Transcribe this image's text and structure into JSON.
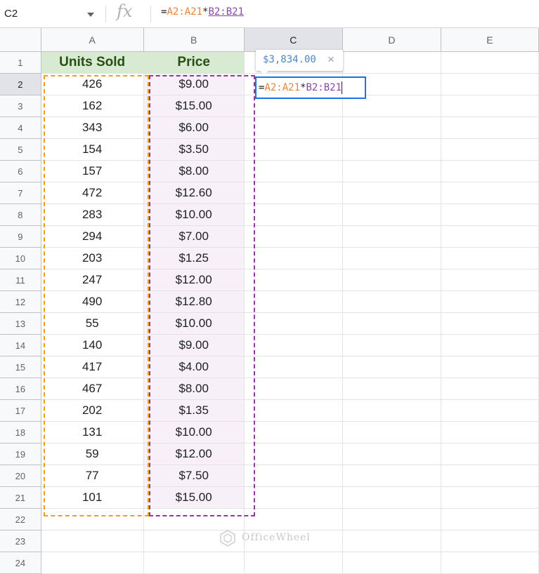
{
  "name_box": {
    "value": "C2"
  },
  "formula_bar": {
    "fx_label": "fx",
    "eq": "=",
    "ref_a": "A2:A21",
    "op": "*",
    "ref_b": "B2:B21"
  },
  "columns": [
    "A",
    "B",
    "C",
    "D",
    "E"
  ],
  "headers": {
    "units": "Units Sold",
    "price": "Price"
  },
  "rows": [
    {
      "n": "1"
    },
    {
      "n": "2",
      "units": "426",
      "price": "$9.00"
    },
    {
      "n": "3",
      "units": "162",
      "price": "$15.00"
    },
    {
      "n": "4",
      "units": "343",
      "price": "$6.00"
    },
    {
      "n": "5",
      "units": "154",
      "price": "$3.50"
    },
    {
      "n": "6",
      "units": "157",
      "price": "$8.00"
    },
    {
      "n": "7",
      "units": "472",
      "price": "$12.60"
    },
    {
      "n": "8",
      "units": "283",
      "price": "$10.00"
    },
    {
      "n": "9",
      "units": "294",
      "price": "$7.00"
    },
    {
      "n": "10",
      "units": "203",
      "price": "$1.25"
    },
    {
      "n": "11",
      "units": "247",
      "price": "$12.00"
    },
    {
      "n": "12",
      "units": "490",
      "price": "$12.80"
    },
    {
      "n": "13",
      "units": "55",
      "price": "$10.00"
    },
    {
      "n": "14",
      "units": "140",
      "price": "$9.00"
    },
    {
      "n": "15",
      "units": "417",
      "price": "$4.00"
    },
    {
      "n": "16",
      "units": "467",
      "price": "$8.00"
    },
    {
      "n": "17",
      "units": "202",
      "price": "$1.35"
    },
    {
      "n": "18",
      "units": "131",
      "price": "$10.00"
    },
    {
      "n": "19",
      "units": "59",
      "price": "$12.00"
    },
    {
      "n": "20",
      "units": "77",
      "price": "$7.50"
    },
    {
      "n": "21",
      "units": "101",
      "price": "$15.00"
    },
    {
      "n": "22"
    },
    {
      "n": "23"
    },
    {
      "n": "24"
    }
  ],
  "tooltip": {
    "value": "$3,834.00",
    "close": "×"
  },
  "watermark": {
    "text": "OfficeWheel"
  },
  "colors": {
    "header_fill": "#d9ead3",
    "header_text": "#274e13",
    "range_a": "#f29b1e",
    "range_b": "#8e3c9c",
    "active_border": "#1a73e8"
  },
  "icons": {
    "fx": "function-icon",
    "dropdown": "chevron-down-icon",
    "close": "close-icon",
    "watermark": "officewheel-logo-icon"
  }
}
